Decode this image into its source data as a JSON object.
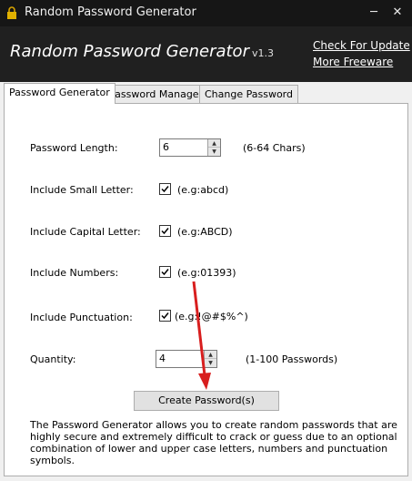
{
  "window": {
    "title": "Random Password Generator",
    "minimize_glyph": "─",
    "close_glyph": "✕"
  },
  "header": {
    "app_name": "Random Password Generator",
    "version": "v1.3",
    "check_update": "Check For Update",
    "more_freeware": "More Freeware"
  },
  "tabs": [
    {
      "label": "Password Generator",
      "active": true
    },
    {
      "label": "Password Manager",
      "active": false
    },
    {
      "label": "Change Password",
      "active": false
    }
  ],
  "form": {
    "length": {
      "label": "Password Length:",
      "value": "6",
      "hint": "(6-64 Chars)"
    },
    "small": {
      "label": "Include Small Letter:",
      "checked": true,
      "hint": "(e.g:abcd)"
    },
    "capital": {
      "label": "Include Capital Letter:",
      "checked": true,
      "hint": "(e.g:ABCD)"
    },
    "numbers": {
      "label": "Include Numbers:",
      "checked": true,
      "hint": "(e.g:01393)"
    },
    "punct": {
      "label": "Include Punctuation:",
      "checked": true,
      "hint": "(e.g:!@#$%^)"
    },
    "quantity": {
      "label": "Quantity:",
      "value": "4",
      "hint": "(1-100 Passwords)"
    }
  },
  "create_button": "Create Password(s)",
  "description": "The Password Generator allows you to create random passwords that are highly secure and extremely difficult to crack or guess due to an optional combination of lower and upper case letters, numbers and punctuation symbols.",
  "icons": {
    "app": "lock-icon",
    "spin_up": "▲",
    "spin_down": "▼"
  },
  "colors": {
    "titlebar": "#161616",
    "header": "#202020",
    "arrow": "#d81e1e"
  }
}
